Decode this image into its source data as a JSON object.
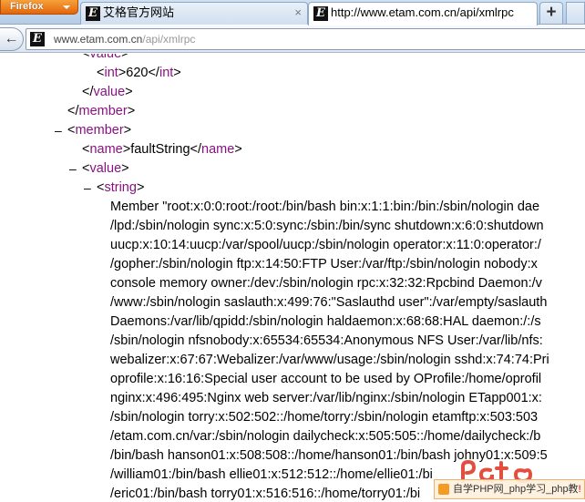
{
  "browser": {
    "app_button_label": "Firefox",
    "tabs": [
      {
        "title": "艾格官方网站",
        "active": false
      },
      {
        "title": "http://www.etam.com.cn/api/xmlrpc",
        "active": true
      }
    ],
    "close_glyph": "×",
    "new_tab_glyph": "+",
    "back_glyph": "←",
    "url": {
      "host": "www.etam.com.cn",
      "path": "/api/xmlrpc"
    }
  },
  "xml": {
    "value_tag": "value",
    "int_tag": "int",
    "int_value": "620",
    "member_tag": "member",
    "name_tag": "name",
    "name_value": "faultString",
    "string_tag": "string",
    "collapse_glyph": "–",
    "string_lines": [
      "Member \"root:x:0:0:root:/root:/bin/bash bin:x:1:1:bin:/bin:/sbin/nologin dae",
      "/lpd:/sbin/nologin sync:x:5:0:sync:/sbin:/bin/sync shutdown:x:6:0:shutdown",
      "uucp:x:10:14:uucp:/var/spool/uucp:/sbin/nologin operator:x:11:0:operator:/",
      "/gopher:/sbin/nologin ftp:x:14:50:FTP User:/var/ftp:/sbin/nologin nobody:x",
      "console memory owner:/dev:/sbin/nologin rpc:x:32:32:Rpcbind Daemon:/v",
      "/www:/sbin/nologin saslauth:x:499:76:\"Saslauthd user\":/var/empty/saslauth",
      "Daemons:/var/lib/qpidd:/sbin/nologin haldaemon:x:68:68:HAL daemon:/:/s",
      "/sbin/nologin nfsnobody:x:65534:65534:Anonymous NFS User:/var/lib/nfs:",
      "webalizer:x:67:67:Webalizer:/var/www/usage:/sbin/nologin sshd:x:74:74:Pri",
      "oprofile:x:16:16:Special user account to be used by OProfile:/home/oprofil",
      "nginx:x:496:495:Nginx web server:/var/lib/nginx:/sbin/nologin ETapp001:x:",
      "/sbin/nologin torry:x:502:502::/home/torry:/sbin/nologin etamftp:x:503:503",
      "/etam.com.cn/var:/sbin/nologin dailycheck:x:505:505::/home/dailycheck:/b",
      "/bin/bash hanson01:x:508:508::/home/hanson01:/bin/bash johny01:x:509:5",
      "/william01:/bin/bash ellie01:x:512:512::/home/ellie01:/bi",
      "/eric01:/bin/bash torry01:x:516:516::/home/torry01:/bi"
    ]
  },
  "watermark": {
    "bar_text": "自学PHP网_php学习_php教",
    "bar_suffix": "!"
  },
  "colors": {
    "tag": "#881280",
    "firefox_orange": "#e2660b"
  }
}
